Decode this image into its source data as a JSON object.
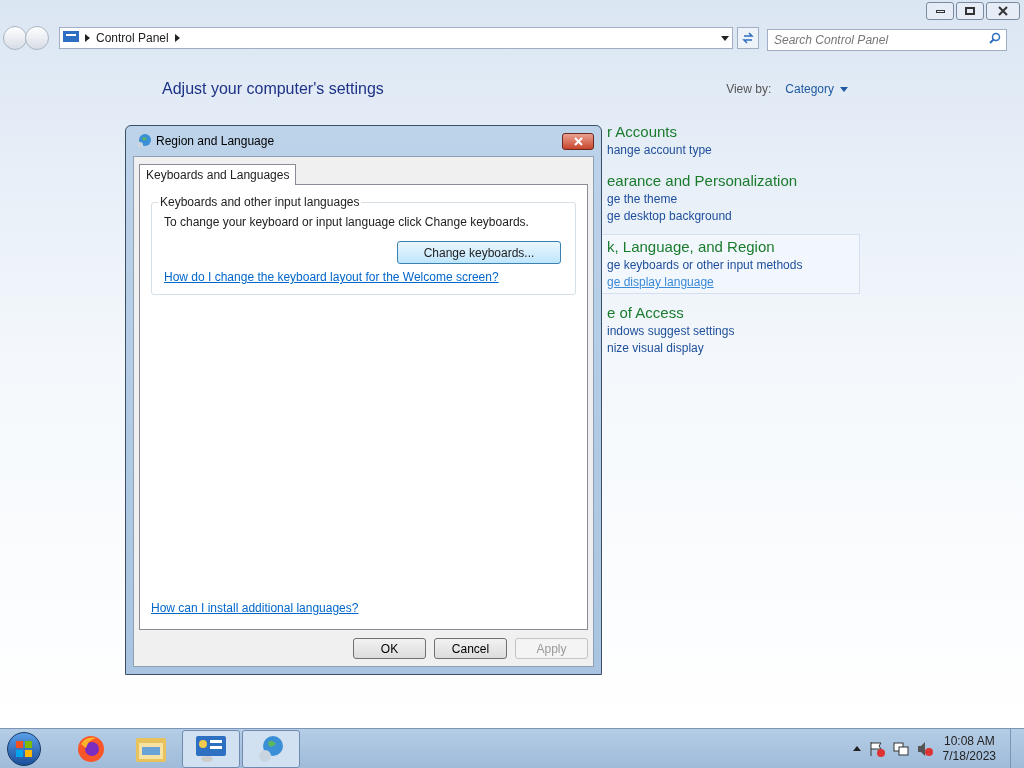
{
  "window": {
    "address": "Control Panel",
    "search_placeholder": "Search Control Panel"
  },
  "heading": "Adjust your computer's settings",
  "view_by": {
    "label": "View by:",
    "value": "Category"
  },
  "categories": [
    {
      "title": "r Accounts",
      "highlighted": false,
      "links": [
        {
          "text": "hange account type",
          "hovered": false
        }
      ]
    },
    {
      "title": "earance and Personalization",
      "highlighted": false,
      "links": [
        {
          "text": "ge the theme",
          "hovered": false
        },
        {
          "text": "ge desktop background",
          "hovered": false
        }
      ]
    },
    {
      "title": "k, Language, and Region",
      "highlighted": true,
      "links": [
        {
          "text": "ge keyboards or other input methods",
          "hovered": false
        },
        {
          "text": "ge display language",
          "hovered": true
        }
      ]
    },
    {
      "title": "e of Access",
      "highlighted": false,
      "links": [
        {
          "text": "indows suggest settings",
          "hovered": false
        },
        {
          "text": "nize visual display",
          "hovered": false
        }
      ]
    }
  ],
  "dialog": {
    "title": "Region and Language",
    "tabs": [
      {
        "label": "Keyboards and Languages",
        "selected": true
      }
    ],
    "group": {
      "title": "Keyboards and other input languages",
      "text": "To change your keyboard or input language click Change keyboards.",
      "button": "Change keyboards...",
      "link": "How do I change the keyboard layout for the Welcome screen?"
    },
    "bottom_link": "How can I install additional languages?",
    "buttons": [
      {
        "label": "OK",
        "disabled": false
      },
      {
        "label": "Cancel",
        "disabled": false
      },
      {
        "label": "Apply",
        "disabled": true
      }
    ]
  },
  "taskbar": {
    "items": [
      {
        "kind": "firefox",
        "selected": false
      },
      {
        "kind": "explorer",
        "selected": false
      },
      {
        "kind": "control-panel",
        "selected": true
      },
      {
        "kind": "globe",
        "selected": true
      }
    ],
    "clock": {
      "time": "10:08 AM",
      "date": "7/18/2023"
    }
  }
}
